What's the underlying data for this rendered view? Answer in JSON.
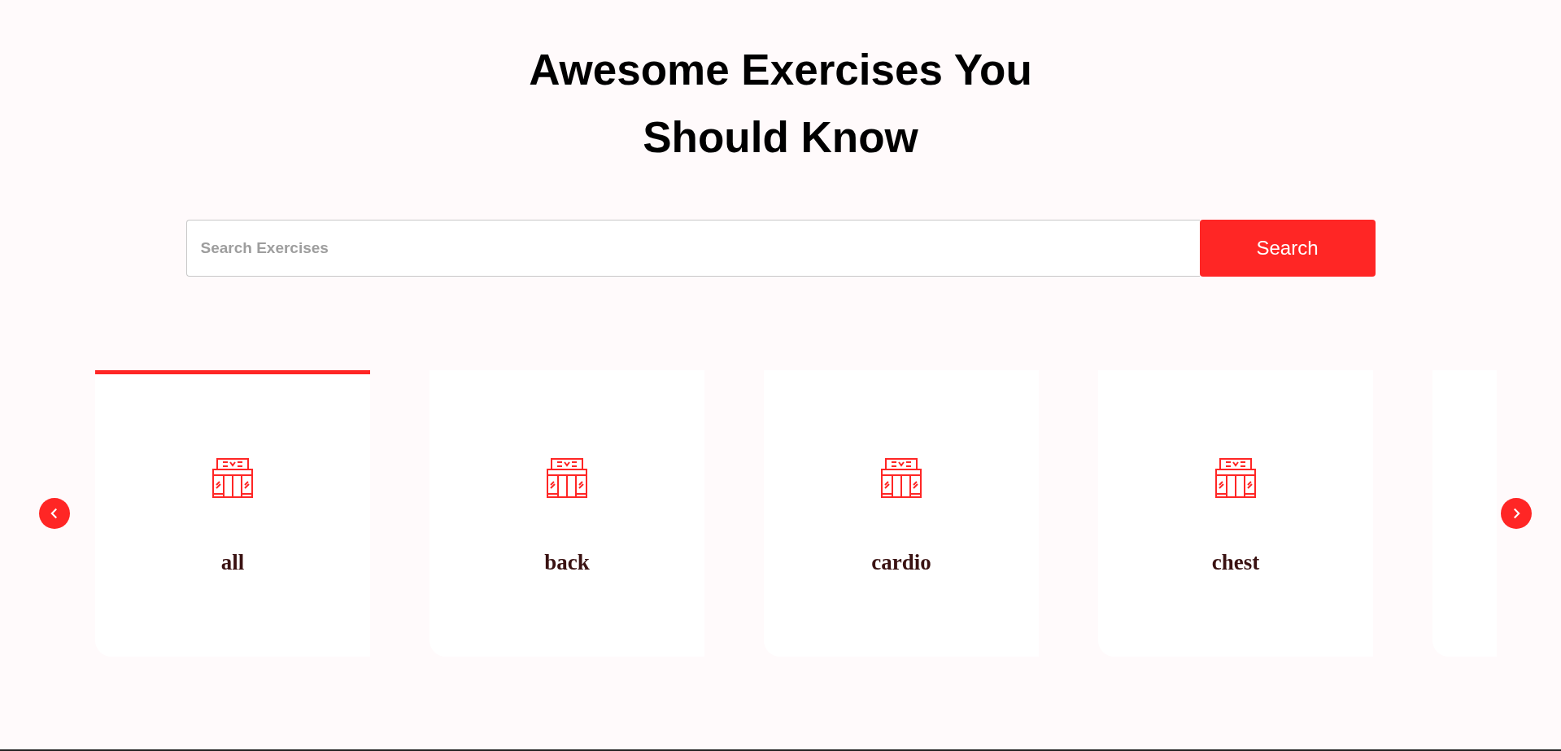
{
  "heading": {
    "line_1": "Awesome Exercises You",
    "line_2": "Should Know"
  },
  "search": {
    "placeholder": "Search Exercises",
    "button": "Search"
  },
  "categories": [
    {
      "label": "all",
      "selected": true
    },
    {
      "label": "back",
      "selected": false
    },
    {
      "label": "cardio",
      "selected": false
    },
    {
      "label": "chest",
      "selected": false
    },
    {
      "selected": false
    }
  ]
}
